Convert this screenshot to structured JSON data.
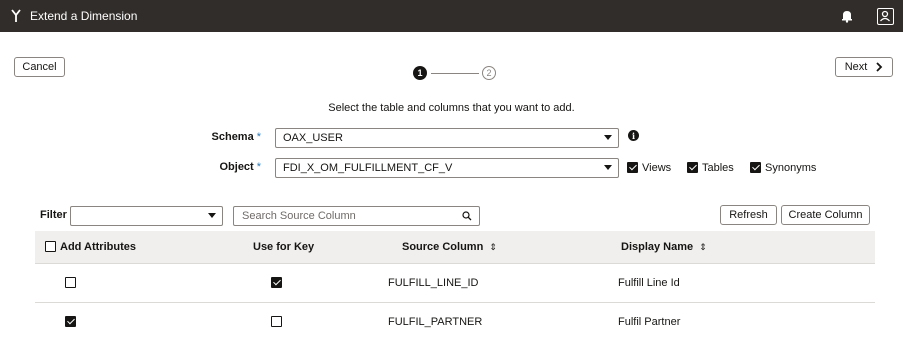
{
  "header": {
    "title": "Extend a Dimension",
    "app_icon": "branch-icon",
    "bell_icon": "bell-icon",
    "profile_icon": "profile-icon"
  },
  "toolbar": {
    "cancel_label": "Cancel",
    "next_label": "Next"
  },
  "train": {
    "step1": "1",
    "step2": "2",
    "current_step": 1
  },
  "instruction": "Select the table and columns that you want to add.",
  "form": {
    "schema_label": "Schema",
    "schema_value": "OAX_USER",
    "object_label": "Object",
    "object_value": "FDI_X_OM_FULFILLMENT_CF_V",
    "required_marker": "*",
    "info_glyph": "i",
    "object_types": [
      {
        "label": "Views",
        "checked": true
      },
      {
        "label": "Tables",
        "checked": true
      },
      {
        "label": "Synonyms",
        "checked": true
      }
    ]
  },
  "filter": {
    "label": "Filter",
    "value": "",
    "search_placeholder": "Search Source Column"
  },
  "actions": {
    "refresh_label": "Refresh",
    "create_column_label": "Create Column"
  },
  "table": {
    "columns": {
      "add_attributes": "Add Attributes",
      "use_for_key": "Use for Key",
      "source_column": "Source Column",
      "display_name": "Display Name"
    },
    "sort_glyph": "⇕",
    "rows": [
      {
        "add_attribute": false,
        "use_for_key": true,
        "source_column": "FULFILL_LINE_ID",
        "display_name": "Fulfill Line Id"
      },
      {
        "add_attribute": true,
        "use_for_key": false,
        "source_column": "FULFIL_PARTNER",
        "display_name": "Fulfil Partner"
      }
    ]
  },
  "colors": {
    "header_bg": "#312d2a",
    "table_header_bg": "#f1efed",
    "required": "#2b7bb9"
  }
}
